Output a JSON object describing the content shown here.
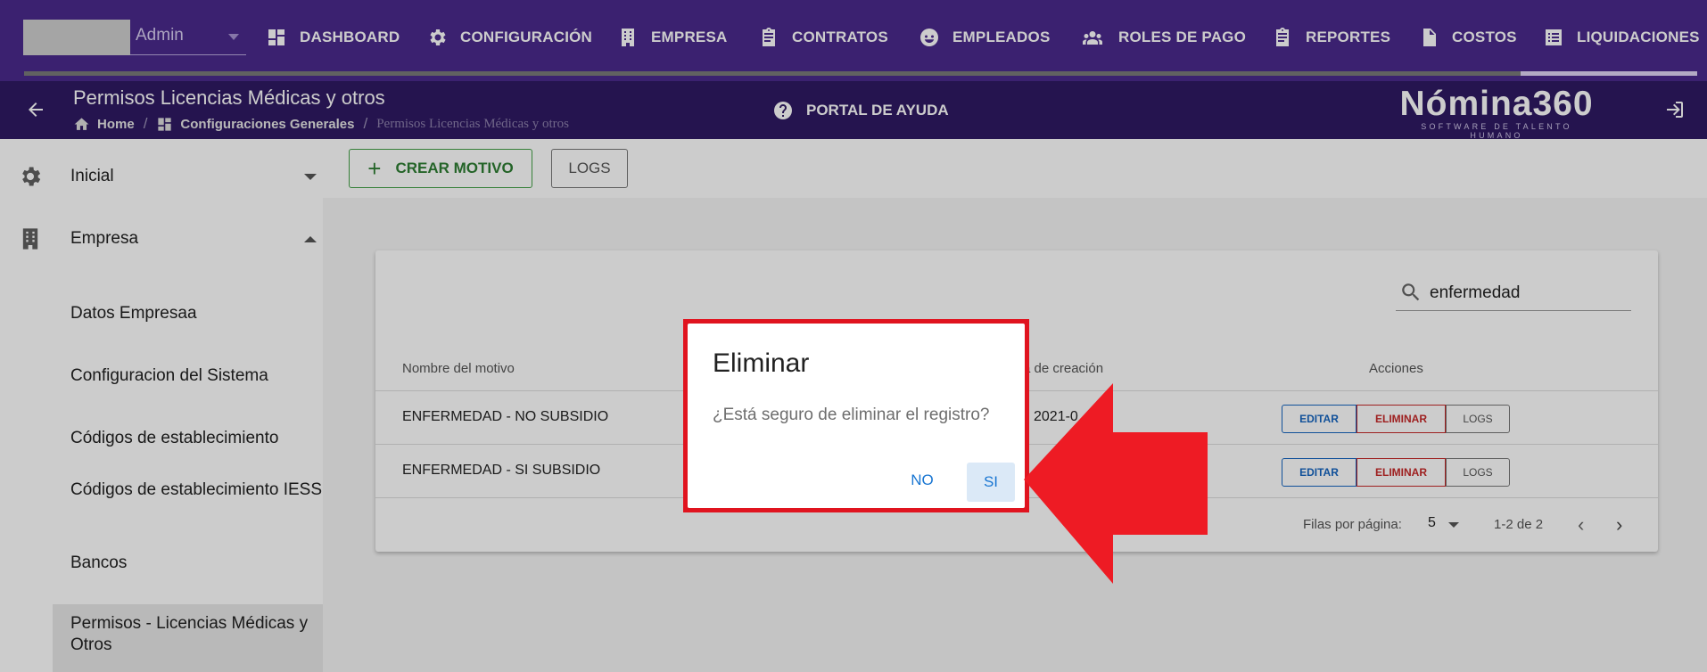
{
  "company_select": {
    "value": "Admin"
  },
  "nav": {
    "items": [
      {
        "label": "DASHBOARD",
        "icon": "dashboard-icon"
      },
      {
        "label": "CONFIGURACIÓN",
        "icon": "gear-icon"
      },
      {
        "label": "EMPRESA",
        "icon": "building-icon"
      },
      {
        "label": "CONTRATOS",
        "icon": "clipboard-icon"
      },
      {
        "label": "EMPLEADOS",
        "icon": "face-icon"
      },
      {
        "label": "ROLES DE PAGO",
        "icon": "people-icon"
      },
      {
        "label": "REPORTES",
        "icon": "clipboard-icon"
      },
      {
        "label": "COSTOS",
        "icon": "dollar-file-icon"
      },
      {
        "label": "LIQUIDACIONES",
        "icon": "list-icon"
      }
    ]
  },
  "subheader": {
    "title": "Permisos Licencias Médicas y otros",
    "breadcrumb": [
      "Home",
      "Configuraciones Generales",
      "Permisos Licencias Médicas y otros"
    ],
    "help_label": "PORTAL DE AYUDA",
    "brand_name": "Nómina360",
    "brand_tagline": "SOFTWARE DE TALENTO HUMANO"
  },
  "sidebar": {
    "sections": [
      {
        "label": "Inicial",
        "icon": "gear-icon",
        "expanded": false
      },
      {
        "label": "Empresa",
        "icon": "building-icon",
        "expanded": true
      }
    ],
    "sub_items": [
      "Datos Empresaa",
      "Configuracion del Sistema",
      "Códigos de establecimiento",
      "Códigos de establecimiento IESS",
      "Bancos",
      "Permisos - Licencias Médicas y Otros"
    ]
  },
  "toolbar": {
    "create_label": "CREAR MOTIVO",
    "logs_label": "LOGS"
  },
  "table": {
    "search_value": "enfermedad",
    "headers": [
      "Nombre del motivo",
      "a de creación",
      "Acciones"
    ],
    "rows": [
      {
        "name": "ENFERMEDAD - NO SUBSIDIO",
        "date": "2021-0"
      },
      {
        "name": "ENFERMEDAD - SI SUBSIDIO",
        "date": ""
      }
    ],
    "actions": {
      "edit": "EDITAR",
      "delete": "ELIMINAR",
      "logs": "LOGS"
    },
    "footer": {
      "rows_per_page_label": "Filas por página:",
      "rows_per_page": "5",
      "range": "1-2 de 2"
    }
  },
  "dialog": {
    "title": "Eliminar",
    "message": "¿Está seguro de eliminar el registro?",
    "no_label": "NO",
    "yes_label": "SI"
  },
  "colors": {
    "nav_bg": "#4a2a8c",
    "subheader_bg": "#2f1a63",
    "highlight_red": "#e0141f",
    "primary_blue": "#1976d2",
    "success_green": "#2e7d32",
    "danger_red": "#c62828"
  }
}
